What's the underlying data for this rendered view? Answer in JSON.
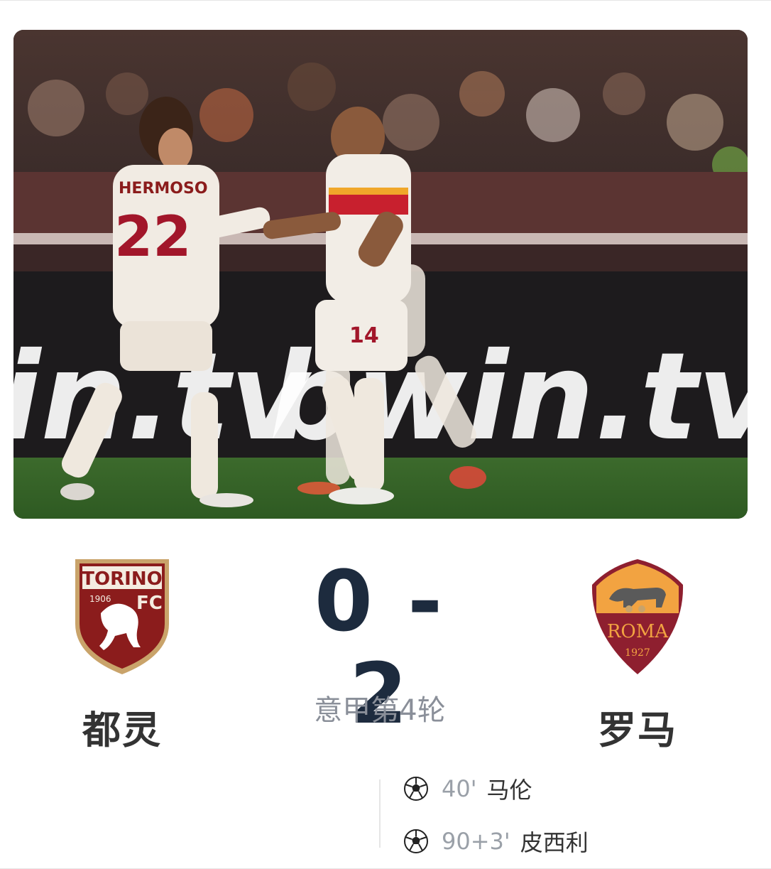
{
  "match": {
    "home_team": "都灵",
    "away_team": "罗马",
    "score": "0 - 2",
    "round": "意甲第4轮"
  },
  "home_crest": {
    "icon": "torino-fc-crest",
    "text_top": "TORINO",
    "text_year": "1906",
    "text_fc": "FC"
  },
  "away_crest": {
    "icon": "as-roma-crest",
    "text_name": "ROMA",
    "text_year": "1927"
  },
  "goals": [
    {
      "icon": "soccer-ball-icon",
      "minute": "40'",
      "scorer": "马伦"
    },
    {
      "icon": "soccer-ball-icon",
      "minute": "90+3'",
      "scorer": "皮西利"
    }
  ],
  "photo": {
    "jersey_left_name": "HERMOSO",
    "jersey_left_number": "22",
    "jersey_right_number": "14",
    "board_text": "bwin.tv",
    "board_text_2": "in.tv"
  },
  "colors": {
    "score": "#1d2b3e",
    "torino_maroon": "#8b1c1c",
    "roma_gold": "#f2a341",
    "roma_red": "#8e1f2f"
  }
}
